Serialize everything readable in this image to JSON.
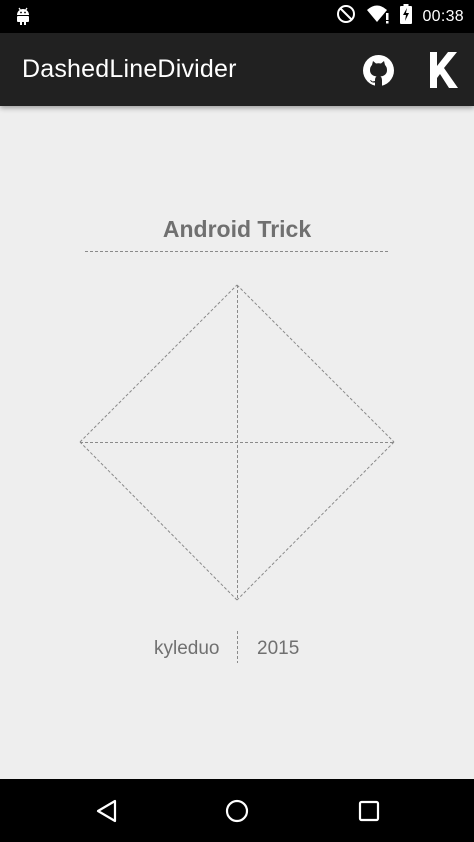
{
  "status_bar": {
    "time": "00:38",
    "icons": [
      "android-icon",
      "do-not-disturb-icon",
      "wifi-icon",
      "battery-charging-icon"
    ]
  },
  "app_bar": {
    "title": "DashedLineDivider",
    "actions": [
      "github-icon",
      "k-logo-icon"
    ]
  },
  "main": {
    "heading": "Android Trick",
    "author": "kyleduo",
    "year": "2015"
  },
  "nav_bar": {
    "buttons": [
      "back-icon",
      "home-icon",
      "recents-icon"
    ]
  },
  "colors": {
    "app_bar": "#212121",
    "background": "#eeeeee",
    "dash_line": "#8a8a8a",
    "text": "#707070"
  }
}
